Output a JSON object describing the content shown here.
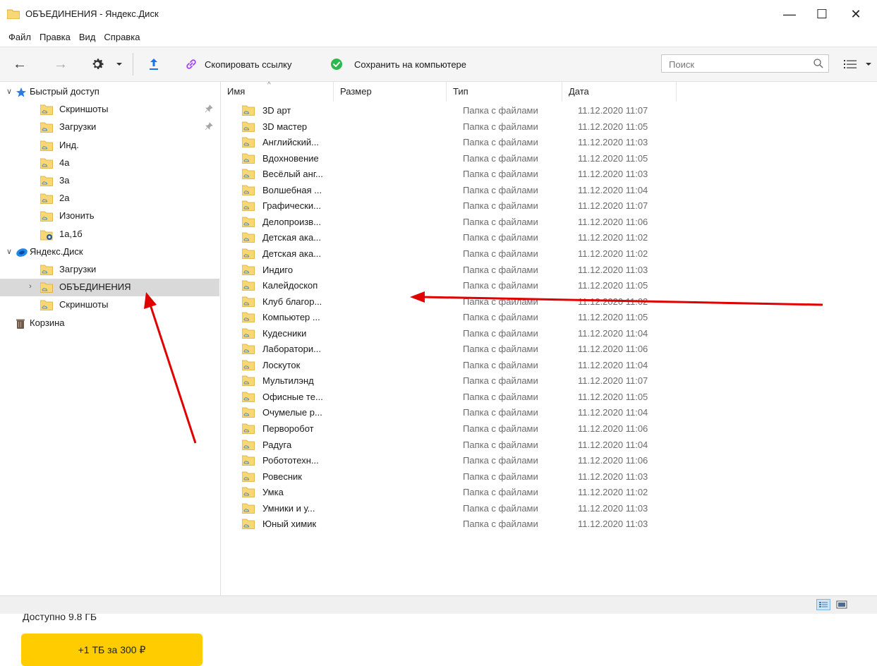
{
  "window": {
    "title": "ОБЪЕДИНЕНИЯ - Яндекс.Диск",
    "minimize": "—",
    "maximize": "☐",
    "close": "✕"
  },
  "menu": [
    "Файл",
    "Правка",
    "Вид",
    "Справка"
  ],
  "toolbar": {
    "back": "←",
    "forward": "→",
    "copy_link_label": "Скопировать ссылку",
    "save_label": "Сохранить на компьютере",
    "search_placeholder": "Поиск"
  },
  "sidebar": {
    "items": [
      {
        "label": "Быстрый доступ",
        "level": 0,
        "expander": "∨",
        "icon": "star-icon",
        "pinned": false,
        "selected": false
      },
      {
        "label": "Скриншоты",
        "level": 1,
        "expander": "",
        "icon": "folder-cloud-icon",
        "pinned": true,
        "selected": false
      },
      {
        "label": "Загрузки",
        "level": 1,
        "expander": "",
        "icon": "folder-cloud-icon",
        "pinned": true,
        "selected": false
      },
      {
        "label": "Инд.",
        "level": 1,
        "expander": "",
        "icon": "folder-cloud-icon",
        "pinned": false,
        "selected": false
      },
      {
        "label": "4а",
        "level": 1,
        "expander": "",
        "icon": "folder-cloud-icon",
        "pinned": false,
        "selected": false
      },
      {
        "label": "3а",
        "level": 1,
        "expander": "",
        "icon": "folder-cloud-icon",
        "pinned": false,
        "selected": false
      },
      {
        "label": "2а",
        "level": 1,
        "expander": "",
        "icon": "folder-cloud-icon",
        "pinned": false,
        "selected": false
      },
      {
        "label": "Изонить",
        "level": 1,
        "expander": "",
        "icon": "folder-cloud-icon",
        "pinned": false,
        "selected": false
      },
      {
        "label": "1а,1б",
        "level": 1,
        "expander": "",
        "icon": "folder-shared-icon",
        "pinned": false,
        "selected": false
      },
      {
        "label": "Яндекс.Диск",
        "level": 0,
        "expander": "∨",
        "icon": "yandex-disk-icon",
        "pinned": false,
        "selected": false
      },
      {
        "label": "Загрузки",
        "level": 1,
        "expander": "",
        "icon": "folder-cloud-icon",
        "pinned": false,
        "selected": false
      },
      {
        "label": "ОБЪЕДИНЕНИЯ",
        "level": 1,
        "expander": "›",
        "icon": "folder-cloud-icon",
        "pinned": false,
        "selected": true
      },
      {
        "label": "Скриншоты",
        "level": 1,
        "expander": "",
        "icon": "folder-cloud-icon",
        "pinned": false,
        "selected": false
      },
      {
        "label": "Корзина",
        "level": 0,
        "expander": "",
        "icon": "trash-icon",
        "pinned": false,
        "selected": false
      }
    ],
    "pin_glyph": "📌",
    "storage_label": "Доступно 9.8 ГБ",
    "buy_button": "+1 ТБ за 300 ₽"
  },
  "filelist": {
    "columns": {
      "name": "Имя",
      "size": "Размер",
      "type": "Тип",
      "date": "Дата"
    },
    "sort_indicator": "^",
    "rows": [
      {
        "name": "3D арт",
        "type": "Папка с файлами",
        "date": "11.12.2020 11:07"
      },
      {
        "name": "3D мастер",
        "type": "Папка с файлами",
        "date": "11.12.2020 11:05"
      },
      {
        "name": "Английский...",
        "type": "Папка с файлами",
        "date": "11.12.2020 11:03"
      },
      {
        "name": "Вдохновение",
        "type": "Папка с файлами",
        "date": "11.12.2020 11:05"
      },
      {
        "name": "Весёлый анг...",
        "type": "Папка с файлами",
        "date": "11.12.2020 11:03"
      },
      {
        "name": "Волшебная ...",
        "type": "Папка с файлами",
        "date": "11.12.2020 11:04"
      },
      {
        "name": "Графически...",
        "type": "Папка с файлами",
        "date": "11.12.2020 11:07"
      },
      {
        "name": "Делопроизв...",
        "type": "Папка с файлами",
        "date": "11.12.2020 11:06"
      },
      {
        "name": "Детская ака...",
        "type": "Папка с файлами",
        "date": "11.12.2020 11:02"
      },
      {
        "name": "Детская ака...",
        "type": "Папка с файлами",
        "date": "11.12.2020 11:02"
      },
      {
        "name": "Индиго",
        "type": "Папка с файлами",
        "date": "11.12.2020 11:03"
      },
      {
        "name": "Калейдоскоп",
        "type": "Папка с файлами",
        "date": "11.12.2020 11:05"
      },
      {
        "name": "Клуб благор...",
        "type": "Папка с файлами",
        "date": "11.12.2020 11:02"
      },
      {
        "name": "Компьютер ...",
        "type": "Папка с файлами",
        "date": "11.12.2020 11:05"
      },
      {
        "name": "Кудесники",
        "type": "Папка с файлами",
        "date": "11.12.2020 11:04"
      },
      {
        "name": "Лаборатори...",
        "type": "Папка с файлами",
        "date": "11.12.2020 11:06"
      },
      {
        "name": "Лоскуток",
        "type": "Папка с файлами",
        "date": "11.12.2020 11:04"
      },
      {
        "name": "Мультилэнд",
        "type": "Папка с файлами",
        "date": "11.12.2020 11:07"
      },
      {
        "name": "Офисные те...",
        "type": "Папка с файлами",
        "date": "11.12.2020 11:05"
      },
      {
        "name": "Очумелые р...",
        "type": "Папка с файлами",
        "date": "11.12.2020 11:04"
      },
      {
        "name": "Перворобот",
        "type": "Папка с файлами",
        "date": "11.12.2020 11:06"
      },
      {
        "name": "Радуга",
        "type": "Папка с файлами",
        "date": "11.12.2020 11:04"
      },
      {
        "name": "Робототехн...",
        "type": "Папка с файлами",
        "date": "11.12.2020 11:06"
      },
      {
        "name": "Ровесник",
        "type": "Папка с файлами",
        "date": "11.12.2020 11:03"
      },
      {
        "name": "Умка",
        "type": "Папка с файлами",
        "date": "11.12.2020 11:02"
      },
      {
        "name": "Умники и у...",
        "type": "Папка с файлами",
        "date": "11.12.2020 11:03"
      },
      {
        "name": "Юный химик",
        "type": "Папка с файлами",
        "date": "11.12.2020 11:03"
      }
    ]
  },
  "colors": {
    "accent_yellow": "#ffcc00",
    "annotation_red": "#e00000",
    "folder_yellow": "#f8d775",
    "link_purple": "#a442f5",
    "save_green": "#2db84c",
    "upload_blue": "#1a73e8"
  }
}
